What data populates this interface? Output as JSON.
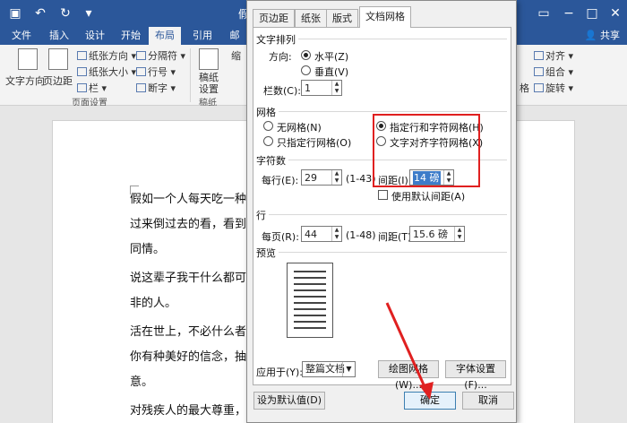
{
  "window": {
    "title": "假",
    "share": "共享"
  },
  "ribbon_tabs": [
    {
      "label": "文件"
    },
    {
      "label": "插入"
    },
    {
      "label": "设计"
    },
    {
      "label": "开始"
    },
    {
      "label": "布局"
    },
    {
      "label": "引用"
    },
    {
      "label": "邮"
    }
  ],
  "ribbon": {
    "text_direction": "文字方向",
    "margins": "页边距",
    "orientation": "纸张方向",
    "size": "纸张大小",
    "columns": "栏",
    "breaks": "分隔符",
    "line_numbers": "行号",
    "hyphenation": "断字",
    "page_setup": "页面设置",
    "draft_paper": "稿纸设置",
    "draft_group": "稿纸",
    "indent_partial": "缩",
    "align": "对齐",
    "group": "组合",
    "rotate": "旋转",
    "arrange_partial": "格"
  },
  "document": {
    "lines": [
      "假如一个人每天吃一种",
      "过来倒过去的看，看到",
      "同情。",
      "说这辈子我干什么都可",
      "非的人。",
      "活在世上，不必什么者",
      "你有种美好的信念，抽",
      "意。",
      "对残疾人的最大尊重，"
    ]
  },
  "dialog": {
    "tabs": [
      {
        "label": "页边距"
      },
      {
        "label": "纸张"
      },
      {
        "label": "版式"
      },
      {
        "label": "文档网格"
      }
    ],
    "text_arrangement": {
      "section": "文字排列",
      "direction_label": "方向:",
      "horizontal": "水平(Z)",
      "vertical": "垂直(V)",
      "columns_label": "栏数(C):",
      "columns_value": "1"
    },
    "grid": {
      "section": "网格",
      "no_grid": "无网格(N)",
      "line_only": "只指定行网格(O)",
      "line_and_char": "指定行和字符网格(H)",
      "snap_to_char": "文字对齐字符网格(X)"
    },
    "characters": {
      "section": "字符数",
      "per_line_label": "每行(E):",
      "per_line_value": "29",
      "per_line_range": "(1-43)",
      "pitch_label": "间距(I):",
      "pitch_value": "14 磅",
      "use_default": "使用默认间距(A)"
    },
    "lines": {
      "section": "行",
      "per_page_label": "每页(R):",
      "per_page_value": "44",
      "per_page_range": "(1-48)",
      "pitch_label": "间距(T):",
      "pitch_value": "15.6 磅"
    },
    "preview": {
      "section": "预览"
    },
    "apply_to_label": "应用于(Y):",
    "apply_to_value": "整篇文档",
    "draw_grid": "绘图网格(W)...",
    "font_settings": "字体设置(F)...",
    "set_default": "设为默认值(D)",
    "ok": "确定",
    "cancel": "取消"
  },
  "colors": {
    "word_blue": "#2b579a",
    "highlight_red": "#e02020"
  }
}
